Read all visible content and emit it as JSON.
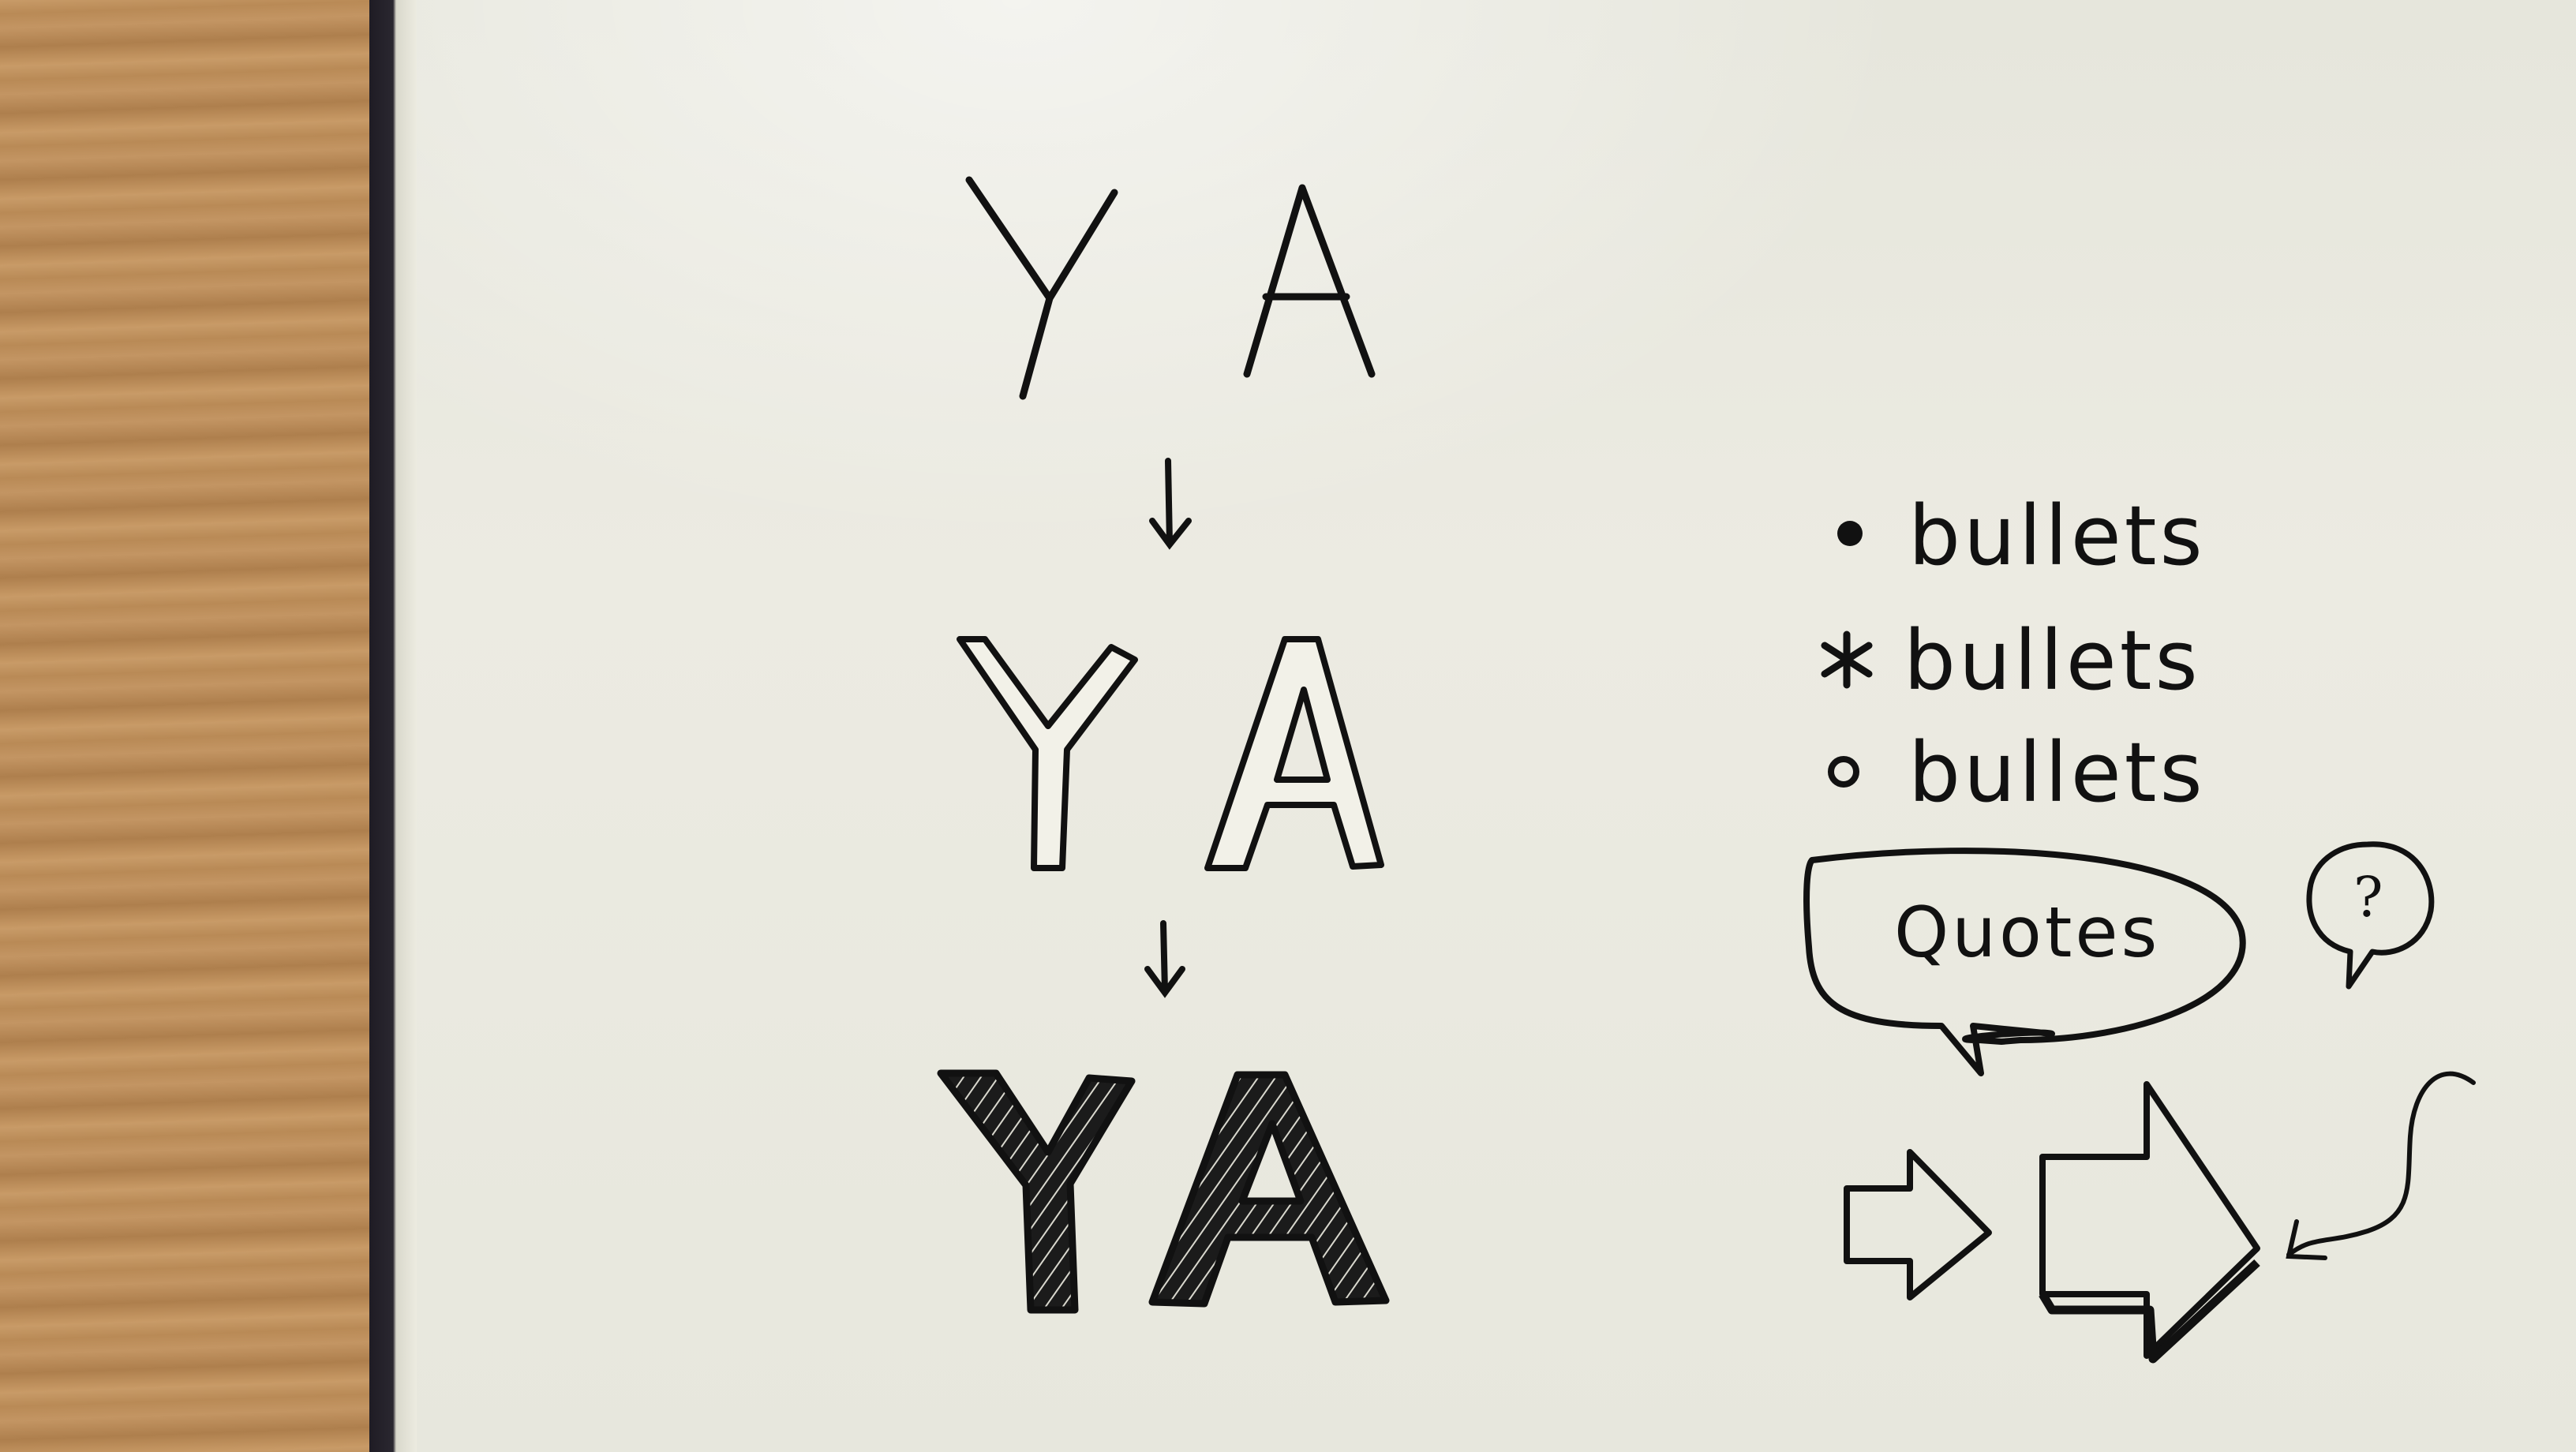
{
  "stage1": {
    "letters": "YA"
  },
  "stage2": {
    "letters": "YA"
  },
  "stage3": {
    "letters": "YA"
  },
  "bullets": [
    {
      "marker": "•",
      "marker_icon": "dot-bullet-icon",
      "text": "bullets"
    },
    {
      "marker": "*",
      "marker_icon": "asterisk-bullet-icon",
      "text": "bullets"
    },
    {
      "marker": "o",
      "marker_icon": "circle-bullet-icon",
      "text": "bullets"
    }
  ],
  "quote_bubble": {
    "text": "Quotes"
  },
  "question_bubble": {
    "text": "?"
  },
  "colors": {
    "ink": "#111111",
    "paper": "#ebeae0",
    "table": "#b88a57"
  }
}
